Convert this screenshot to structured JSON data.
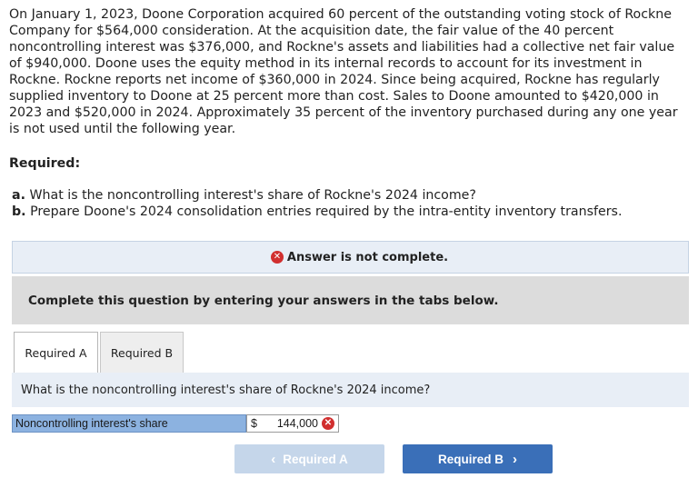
{
  "problem": {
    "text": "On January 1, 2023, Doone Corporation acquired 60 percent of the outstanding voting stock of Rockne Company for $564,000 consideration. At the acquisition date, the fair value of the 40 percent noncontrolling interest was $376,000, and Rockne's assets and liabilities had a collective net fair value of $940,000. Doone uses the equity method in its internal records to account for its investment in Rockne. Rockne reports net income of $360,000 in 2024. Since being acquired, Rockne has regularly supplied inventory to Doone at 25 percent more than cost. Sales to Doone amounted to $420,000 in 2023 and $520,000 in 2024. Approximately 35 percent of the inventory purchased during any one year is not used until the following year."
  },
  "required": {
    "heading": "Required:",
    "items": [
      {
        "letter": "a.",
        "text": "What is the noncontrolling interest's share of Rockne's 2024 income?"
      },
      {
        "letter": "b.",
        "text": "Prepare Doone's 2024 consolidation entries required by the intra-entity inventory transfers."
      }
    ]
  },
  "status": {
    "text": "Answer is not complete.",
    "icon": "x-circle-icon",
    "color": "#d12f2f"
  },
  "instruction": {
    "text": "Complete this question by entering your answers in the tabs below."
  },
  "tabs": [
    {
      "label": "Required A",
      "active": true
    },
    {
      "label": "Required B",
      "active": false
    }
  ],
  "question": {
    "text": "What is the noncontrolling interest's share of Rockne's 2024 income?"
  },
  "answer": {
    "label": "Noncontrolling interest's share",
    "currency": "$",
    "value": "144,000",
    "status_icon": "x-circle-icon"
  },
  "nav": {
    "prev_label": "Required A",
    "next_label": "Required B",
    "accent": "#3a6fb8"
  }
}
